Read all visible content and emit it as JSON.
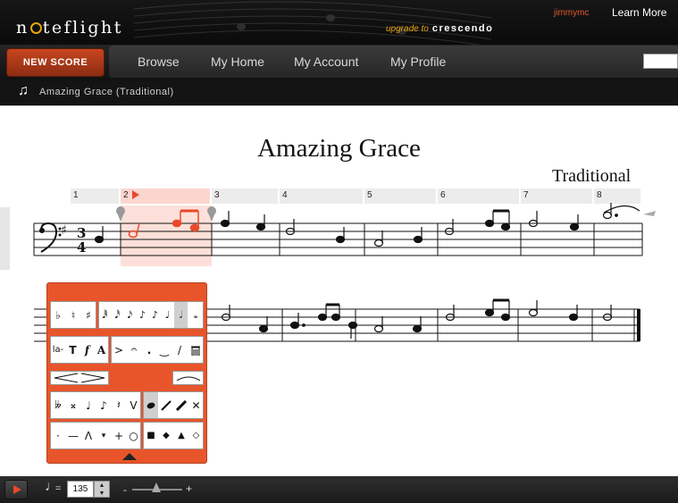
{
  "header": {
    "logo_text": "noteflight",
    "upgrade_label": "upgrade to",
    "upgrade_brand": "crescendo",
    "username": "jimmymc",
    "learn_more": "Learn More",
    "accent_color": "#e8a40c"
  },
  "nav": {
    "new_score": "NEW SCORE",
    "items": [
      "Browse",
      "My Home",
      "My Account",
      "My Profile"
    ],
    "search_placeholder": ""
  },
  "score_bar": {
    "icon": "music-note-icon",
    "title": "Amazing Grace (Traditional)"
  },
  "score": {
    "title": "Amazing Grace",
    "composer": "Traditional",
    "clef": "bass",
    "key_signature": "G major (1 sharp)",
    "time_signature": "3/4",
    "measure_numbers": [
      "1",
      "2",
      "3",
      "4",
      "5",
      "6",
      "7",
      "8"
    ],
    "selected_measure": "2",
    "selection_color": "#e8492b"
  },
  "palette": {
    "accidentals": [
      "♭",
      "♮",
      "♯"
    ],
    "text_tools": [
      "la-",
      "T",
      "f",
      "A"
    ],
    "articulations": [
      ">",
      "𝄐",
      ".",
      "‿",
      "/"
    ],
    "row4": [
      "𝄫",
      "𝄪",
      "♩",
      "♪",
      "𝄽",
      "V"
    ],
    "row5": [
      "·",
      "—",
      "Λ",
      "▾",
      "+",
      "○",
      "■",
      "◆",
      "▲",
      "◇"
    ],
    "icons": [
      "trash-icon",
      "crescendo-icon",
      "decrescendo-icon",
      "slur-icon",
      "collapse-arrow-icon"
    ]
  },
  "playback": {
    "tempo": "135",
    "tempo_equals": "=",
    "zoom_minus": "-",
    "zoom_plus": "+",
    "zoom_level": 0.4
  }
}
